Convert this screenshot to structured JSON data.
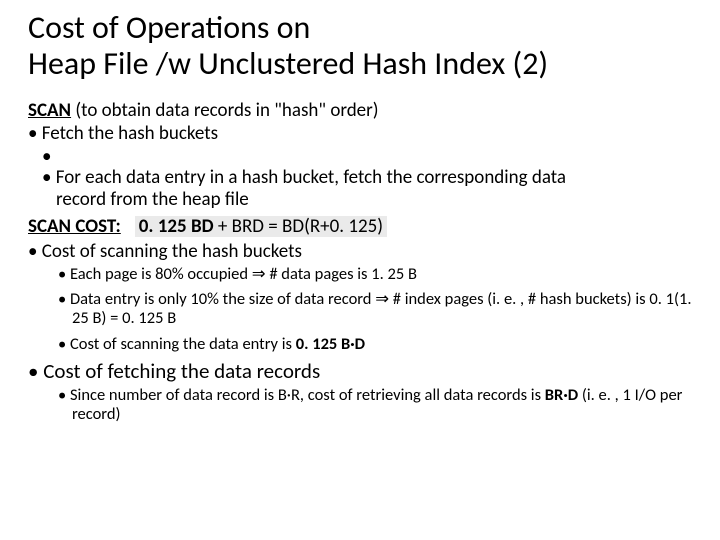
{
  "title_line1": "Cost of Operations on",
  "title_line2": "Heap File /w Unclustered Hash Index (2)",
  "scan_label": "SCAN",
  "scan_desc": " (to obtain data records in \"hash\" order)",
  "b1": "Fetch the hash buckets",
  "b2a": "For each data entry in a hash bucket, fetch the corresponding data",
  "b2b": "record from the heap file",
  "scan_cost_label": "SCAN COST:",
  "formula_l": "0. 125 BD",
  "formula_r": " + BRD =  BD(R+0. 125)",
  "b3": "Cost of scanning the hash buckets",
  "s1a": "Each page is 80% occupied ",
  "s1b": " # data pages is 1. 25 B",
  "s2a": "Data entry is only 10% the size of data record ",
  "s2b": " # index pages (i. e. , # hash buckets) is 0. 1(1. 25 B) = 0. 125 B",
  "s3a": "Cost of scanning the data entry is ",
  "s3b": "0. 125 B·D",
  "b4": "Cost of fetching the data records",
  "s4a": "Since number of data record is B·R, cost of retrieving all data records is ",
  "s4b": "BR·D",
  "s4c": " (i. e. , 1 I/O per record)",
  "arrow": "⇒"
}
